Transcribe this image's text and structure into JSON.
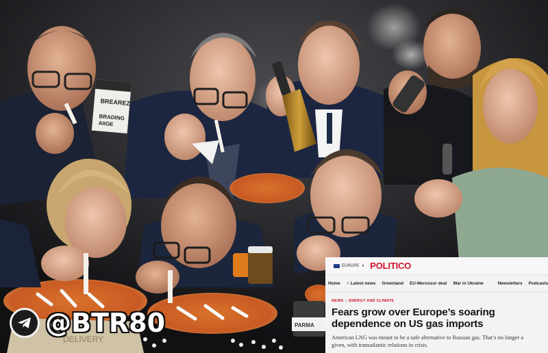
{
  "watermark": {
    "handle": "@BTR80",
    "icon": "telegram-icon"
  },
  "props": {
    "cigarette_pack_text_1": "BREAREZ",
    "cigarette_pack_text_2": "BRADING",
    "cigarette_pack_text_3": "AIIGE",
    "pizza_box_text": "DELIVERY",
    "jar_text": "PARMA"
  },
  "article": {
    "region": "EUROPE",
    "brand": "POLITICO",
    "brand_color": "#d0112b",
    "nav": [
      "Home",
      "Latest news",
      "Greenland",
      "EU-Mercosur deal",
      "War in Ukraine",
      "Newsletters",
      "Podcasts"
    ],
    "tags": [
      "NEWS",
      "ENERGY AND CLIMATE"
    ],
    "headline_line1": "Fears grow over Europe’s soaring",
    "headline_line2": "dependence on US gas imports",
    "dek_line1": "American LNG was meant to be a safe alternative to Russian gas. That’s no longer a",
    "dek_line2": "given, with transatlantic relations in crisis."
  }
}
